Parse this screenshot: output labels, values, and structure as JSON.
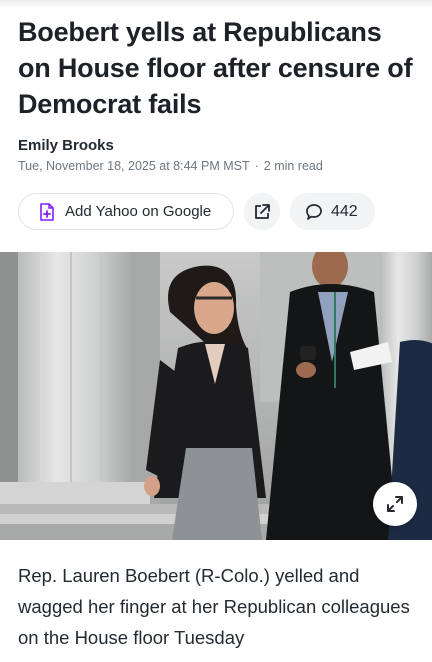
{
  "article": {
    "headline": "Boebert yells at Republicans on House floor after censure of Democrat fails",
    "author": "Emily Brooks",
    "timestamp": "Tue, November 18, 2025 at 8:44 PM MST",
    "separator": "·",
    "read_time": "2 min read",
    "body_first_paragraph": "Rep. Lauren Boebert (R-Colo.) yelled and wagged her finger at her Republican colleagues on the House floor Tuesday"
  },
  "actions": {
    "add_source_label": "Add Yahoo on Google",
    "add_source_icon": "google-add-doc-icon",
    "share_icon": "share-external-icon",
    "comments_icon": "comment-bubble-icon",
    "comments_count": "442"
  },
  "photo": {
    "expand_icon": "expand-diagonal-icon"
  },
  "colors": {
    "accent_purple": "#7e1fff",
    "text_primary": "#1d2228",
    "text_muted": "#6e7780",
    "pill_bg": "#f1f3f5"
  }
}
